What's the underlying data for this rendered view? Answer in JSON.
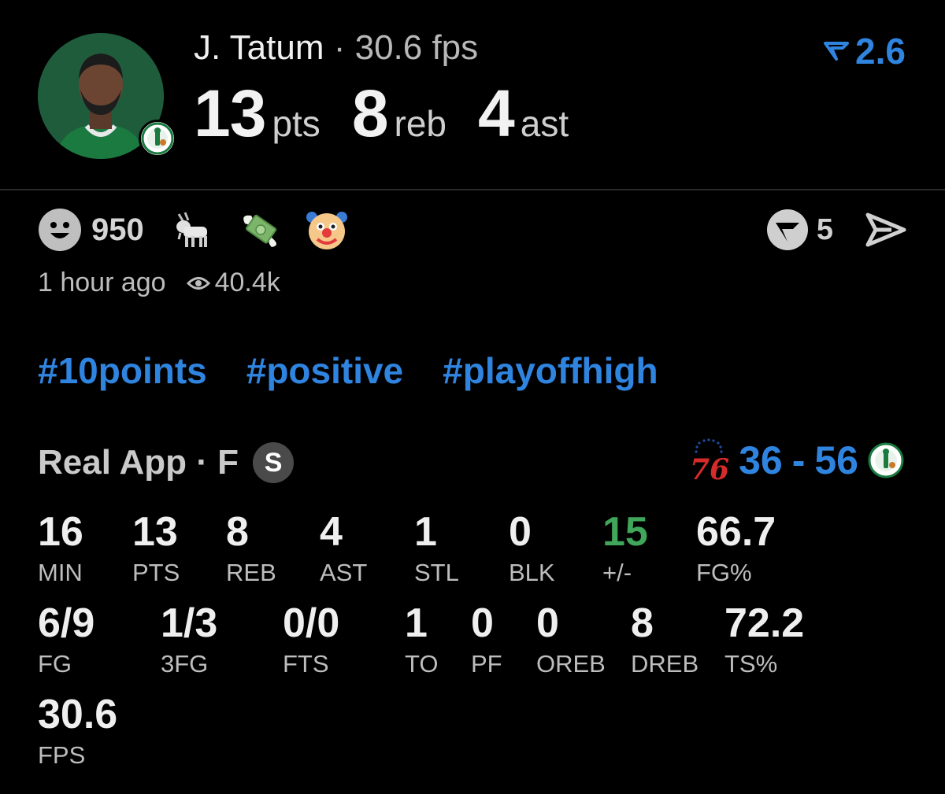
{
  "player": {
    "name": "J. Tatum",
    "separator": " · ",
    "fps_label": "30.6 fps",
    "points_value": "13",
    "points_unit": "pts",
    "rebounds_value": "8",
    "rebounds_unit": "reb",
    "assists_value": "4",
    "assists_unit": "ast",
    "rating": "2.6"
  },
  "reactions": {
    "smile_count": "950",
    "emoji_icons": [
      "goat-emoji-icon",
      "money-with-wings-emoji-icon",
      "clown-emoji-icon"
    ],
    "comments_count": "5"
  },
  "meta": {
    "time_ago": "1 hour ago",
    "views": "40.4k"
  },
  "hashtags": [
    "#10points",
    "#positive",
    "#playoffhigh"
  ],
  "box_header": {
    "source": "Real App · F",
    "badge": "S",
    "away_score": "36",
    "dash": "-",
    "home_score": "56",
    "away_logo_text": "76"
  },
  "box_score": {
    "row1": [
      {
        "value": "16",
        "label": "MIN"
      },
      {
        "value": "13",
        "label": "PTS"
      },
      {
        "value": "8",
        "label": "REB"
      },
      {
        "value": "4",
        "label": "AST"
      },
      {
        "value": "1",
        "label": "STL"
      },
      {
        "value": "0",
        "label": "BLK"
      },
      {
        "value": "15",
        "label": "+/-"
      },
      {
        "value": "66.7",
        "label": "FG%"
      }
    ],
    "row2": [
      {
        "value": "6/9",
        "label": "FG"
      },
      {
        "value": "1/3",
        "label": "3FG"
      },
      {
        "value": "0/0",
        "label": "FTS"
      },
      {
        "value": "1",
        "label": "TO"
      },
      {
        "value": "0",
        "label": "PF"
      },
      {
        "value": "0",
        "label": "OREB"
      },
      {
        "value": "8",
        "label": "DREB"
      },
      {
        "value": "72.2",
        "label": "TS%"
      }
    ],
    "row3": [
      {
        "value": "30.6",
        "label": "FPS"
      }
    ]
  },
  "colors": {
    "accent_blue": "#2f84e0",
    "positive_green": "#3fa65a",
    "background": "#000000"
  }
}
